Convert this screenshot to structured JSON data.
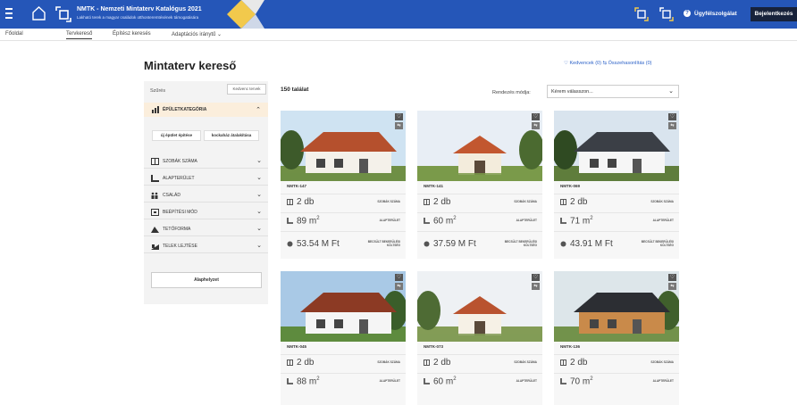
{
  "header": {
    "title": "NMTK - Nemzeti Mintaterv Katalógus 2021",
    "subtitle": "Lakható terek a magyar családok otthonteremtésének támogatására",
    "help_label": "Ügyfélszolgálat",
    "login_label": "Bejelentkezés",
    "brand_color": "#2556b8"
  },
  "nav": {
    "items": [
      "Főoldal",
      "Tervkereső",
      "Építész keresés",
      "Adaptációs iránytű ⌄"
    ],
    "active": "Tervkereső"
  },
  "page": {
    "title": "Mintaterv kereső",
    "favorites_link": "Kedvencek (0)",
    "compare_link": "Összehasonlítás (0)"
  },
  "sidebar": {
    "filter_tab": "Szűrés",
    "favorites_button": "Kedvenc tervek",
    "category_label": "ÉPÜLETKATEGÓRIA",
    "chips": [
      "új épület építése",
      "kockaház átalakítása"
    ],
    "facets": [
      "SZOBÁK SZÁMA",
      "ALAPTERÜLET",
      "CSALÁD",
      "BEÉPÍTÉSI MÓD",
      "TETŐFORMA",
      "TELEK LEJTÉSE"
    ],
    "reset_button": "Alaphelyzet"
  },
  "results": {
    "count": "150 találat",
    "sort_label": "Rendezés módja:",
    "sort_value": "Kérem válasszon..."
  },
  "labels": {
    "rooms": "SZOBÁK SZÁMA",
    "area": "ALAPTERÜLET",
    "cost": "BECSÜLT BEKERÜLÉSI KÖLTSÉG"
  },
  "cards": [
    {
      "code": "NMTK-147",
      "rooms": "2 db",
      "area": "89 m",
      "cost": "53.54 M Ft"
    },
    {
      "code": "NMTK-141",
      "rooms": "2 db",
      "area": "60 m",
      "cost": "37.59 M Ft"
    },
    {
      "code": "NMTK-069",
      "rooms": "2 db",
      "area": "71 m",
      "cost": "43.91 M Ft"
    },
    {
      "code": "NMTK-045",
      "rooms": "2 db",
      "area": "88 m",
      "cost": ""
    },
    {
      "code": "NMTK-073",
      "rooms": "2 db",
      "area": "60 m",
      "cost": ""
    },
    {
      "code": "NMTK-136",
      "rooms": "2 db",
      "area": "70 m",
      "cost": ""
    }
  ],
  "area_unit_sup": "2"
}
